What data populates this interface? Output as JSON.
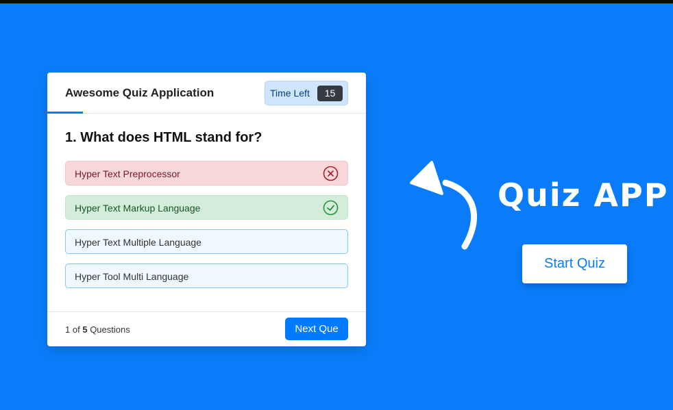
{
  "quiz": {
    "title": "Awesome Quiz Application",
    "timer_label": "Time Left",
    "timer_value": "15",
    "question": "1. What does HTML stand for?",
    "options": [
      {
        "label": "Hyper Text Preprocessor",
        "state": "incorrect",
        "icon": "cross-circle-icon"
      },
      {
        "label": "Hyper Text Markup Language",
        "state": "correct",
        "icon": "check-circle-icon"
      },
      {
        "label": "Hyper Text Multiple Language",
        "state": "neutral"
      },
      {
        "label": "Hyper Tool Multi Language",
        "state": "neutral"
      }
    ],
    "counter": {
      "current": "1",
      "of": "of",
      "total": "5",
      "suffix": "Questions"
    },
    "next_label": "Next Que"
  },
  "hero": {
    "title": "Quiz APP",
    "start_label": "Start Quiz",
    "arrow_icon": "curved-arrow-icon"
  },
  "colors": {
    "background": "#0a7cfa",
    "primary": "#007bff",
    "correct_bg": "#d4edda",
    "incorrect_bg": "#f8d7da"
  }
}
